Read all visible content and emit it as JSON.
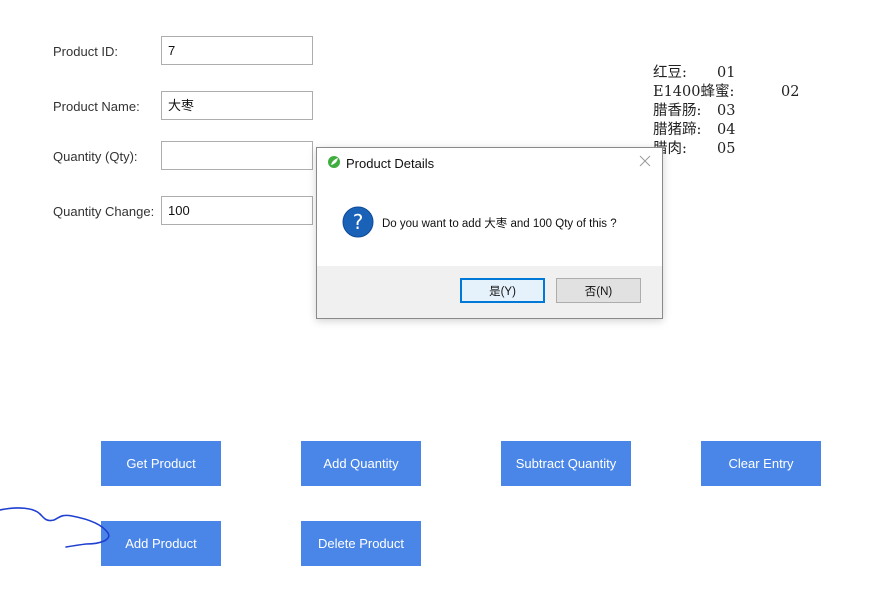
{
  "form": {
    "product_id_label": "Product ID:",
    "product_id_value": "7",
    "product_name_label": "Product Name:",
    "product_name_value": "大枣",
    "quantity_label": "Quantity (Qty):",
    "quantity_value": "",
    "quantity_change_label": "Quantity Change:",
    "quantity_change_value": "100"
  },
  "legend": [
    {
      "name": "红豆:",
      "id": "01"
    },
    {
      "name": "E1400蜂蜜:",
      "id": "02"
    },
    {
      "name": "腊香肠:",
      "id": "03"
    },
    {
      "name": "腊猪蹄:",
      "id": "04"
    },
    {
      "name": "腊肉:",
      "id": "05"
    }
  ],
  "buttons": {
    "get_product": "Get Product",
    "add_quantity": "Add Quantity",
    "subtract_quantity": "Subtract Quantity",
    "clear_entry": "Clear Entry",
    "add_product": "Add Product",
    "delete_product": "Delete Product"
  },
  "dialog": {
    "title": "Product Details",
    "message": "Do you want to add 大枣 and 100 Qty of this ?",
    "yes_label": "是(Y)",
    "no_label": "否(N)",
    "app_icon": "leaf-icon",
    "message_icon": "question-icon",
    "close_icon": "close-icon"
  },
  "colors": {
    "button_bg": "#4a86e8",
    "dialog_accent": "#0078d7",
    "scribble": "#1f3fd1"
  }
}
